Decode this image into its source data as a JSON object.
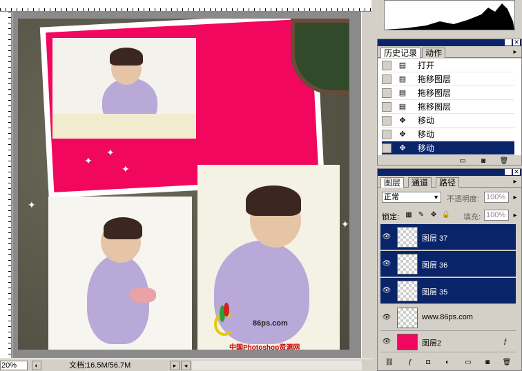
{
  "canvas": {
    "zoom": "20%",
    "doc_info": "文档:16.5M/56.7M",
    "watermark": {
      "line1": "86ps.com",
      "line2": "www.86ps.com",
      "line3": "中国Photoshop资源网"
    }
  },
  "history_panel": {
    "tabs": [
      {
        "label": "历史记录",
        "active": true
      },
      {
        "label": "动作",
        "active": false
      }
    ],
    "items": [
      {
        "label": "打开",
        "icon": "document-icon",
        "selected": false
      },
      {
        "label": "拖移图层",
        "icon": "document-icon",
        "selected": false
      },
      {
        "label": "拖移图层",
        "icon": "document-icon",
        "selected": false
      },
      {
        "label": "拖移图层",
        "icon": "document-icon",
        "selected": false
      },
      {
        "label": "移动",
        "icon": "move-icon",
        "selected": false
      },
      {
        "label": "移动",
        "icon": "move-icon",
        "selected": false
      },
      {
        "label": "移动",
        "icon": "move-icon",
        "selected": true
      }
    ]
  },
  "layers_panel": {
    "tabs": [
      {
        "label": "图层",
        "active": true
      },
      {
        "label": "通道",
        "active": false
      },
      {
        "label": "路径",
        "active": false
      }
    ],
    "blend_mode": "正常",
    "opacity_label": "不透明度:",
    "opacity_value": "100%",
    "lock_label": "锁定:",
    "fill_label": "填充:",
    "fill_value": "100%",
    "layers": [
      {
        "name": "图层 37",
        "selected": true
      },
      {
        "name": "图层 36",
        "selected": true
      },
      {
        "name": "图层 35",
        "selected": true
      },
      {
        "name": "www.86ps.com",
        "selected": false
      },
      {
        "name": "图层2",
        "selected": false
      }
    ]
  },
  "colors": {
    "selection": "#0a246a",
    "pink": "#f2075e",
    "panel_bg": "#d4d0c8"
  }
}
